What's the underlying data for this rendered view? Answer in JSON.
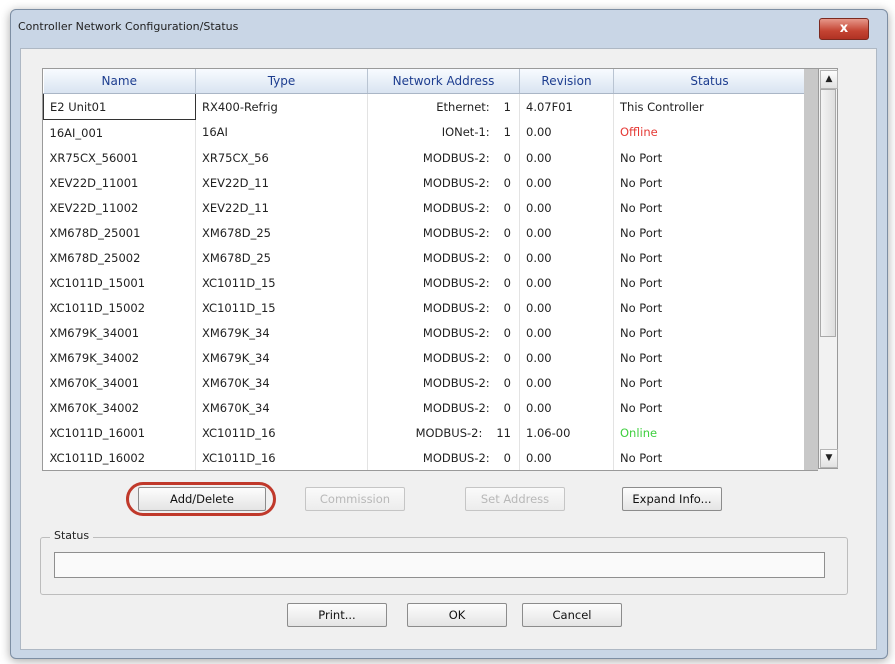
{
  "dialog": {
    "title": "Controller Network Configuration/Status",
    "close_glyph": "x",
    "close_icon": "close-icon"
  },
  "table": {
    "headers": [
      "Name",
      "Type",
      "Network Address",
      "Revision",
      "Status"
    ],
    "rows": [
      {
        "name": "E2 Unit01",
        "type": "RX400-Refrig",
        "net": "Ethernet:",
        "addr": "1",
        "rev": "4.07F01",
        "status": "This Controller"
      },
      {
        "name": "16AI_001",
        "type": "16AI",
        "net": "IONet-1:",
        "addr": "1",
        "rev": "0.00",
        "status": "Offline"
      },
      {
        "name": "XR75CX_56001",
        "type": "XR75CX_56",
        "net": "MODBUS-2:",
        "addr": "0",
        "rev": "0.00",
        "status": "No Port"
      },
      {
        "name": "XEV22D_11001",
        "type": "XEV22D_11",
        "net": "MODBUS-2:",
        "addr": "0",
        "rev": "0.00",
        "status": "No Port"
      },
      {
        "name": "XEV22D_11002",
        "type": "XEV22D_11",
        "net": "MODBUS-2:",
        "addr": "0",
        "rev": "0.00",
        "status": "No Port"
      },
      {
        "name": "XM678D_25001",
        "type": "XM678D_25",
        "net": "MODBUS-2:",
        "addr": "0",
        "rev": "0.00",
        "status": "No Port"
      },
      {
        "name": "XM678D_25002",
        "type": "XM678D_25",
        "net": "MODBUS-2:",
        "addr": "0",
        "rev": "0.00",
        "status": "No Port"
      },
      {
        "name": "XC1011D_15001",
        "type": "XC1011D_15",
        "net": "MODBUS-2:",
        "addr": "0",
        "rev": "0.00",
        "status": "No Port"
      },
      {
        "name": "XC1011D_15002",
        "type": "XC1011D_15",
        "net": "MODBUS-2:",
        "addr": "0",
        "rev": "0.00",
        "status": "No Port"
      },
      {
        "name": "XM679K_34001",
        "type": "XM679K_34",
        "net": "MODBUS-2:",
        "addr": "0",
        "rev": "0.00",
        "status": "No Port"
      },
      {
        "name": "XM679K_34002",
        "type": "XM679K_34",
        "net": "MODBUS-2:",
        "addr": "0",
        "rev": "0.00",
        "status": "No Port"
      },
      {
        "name": "XM670K_34001",
        "type": "XM670K_34",
        "net": "MODBUS-2:",
        "addr": "0",
        "rev": "0.00",
        "status": "No Port"
      },
      {
        "name": "XM670K_34002",
        "type": "XM670K_34",
        "net": "MODBUS-2:",
        "addr": "0",
        "rev": "0.00",
        "status": "No Port"
      },
      {
        "name": "XC1011D_16001",
        "type": "XC1011D_16",
        "net": "MODBUS-2:",
        "addr": "11",
        "rev": "1.06-00",
        "status": "Online"
      },
      {
        "name": "XC1011D_16002",
        "type": "XC1011D_16",
        "net": "MODBUS-2:",
        "addr": "0",
        "rev": "0.00",
        "status": "No Port"
      }
    ],
    "status_colors": {
      "Offline": "#e53935",
      "Online": "#3ecf3e",
      "default": "#222222"
    }
  },
  "scrollbar": {
    "up_glyph": "▲",
    "down_glyph": "▼"
  },
  "buttons": {
    "add_delete": "Add/Delete",
    "commission": "Commission",
    "set_address": "Set Address",
    "expand_info": "Expand Info...",
    "print": "Print...",
    "ok": "OK",
    "cancel": "Cancel"
  },
  "status_group": {
    "label": "Status",
    "value": ""
  },
  "colors": {
    "highlight": "#c0392b",
    "header_text": "#1d3d8f"
  }
}
